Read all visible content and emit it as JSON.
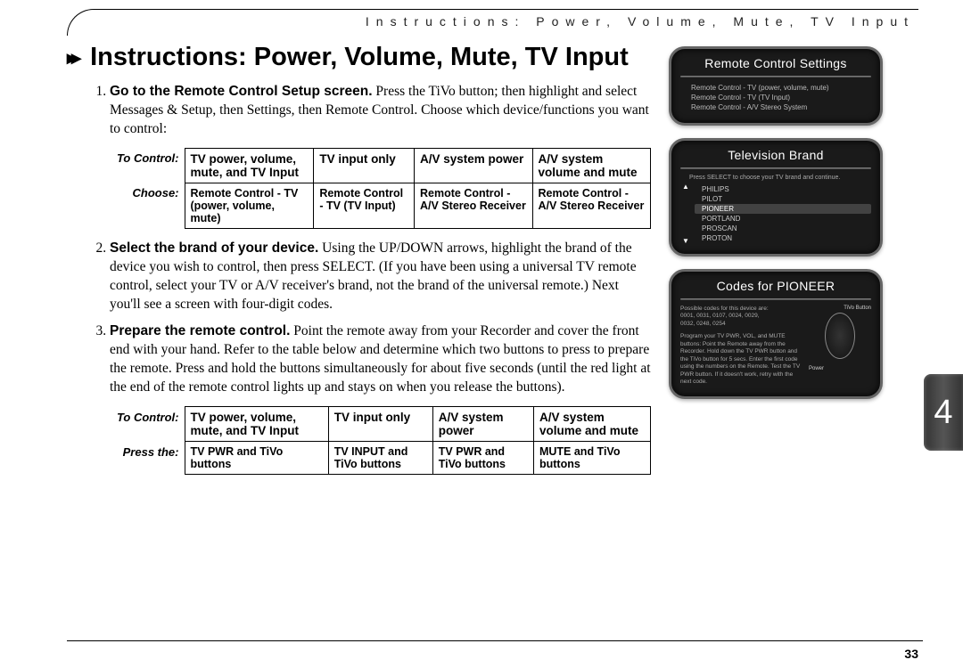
{
  "running_head": "Instructions: Power, Volume, Mute, TV Input",
  "title_icon": "▸▸",
  "title": "Instructions: Power, Volume, Mute, TV Input",
  "chapter_tab": "4",
  "page_number": "33",
  "step1": {
    "lead": "Go to the Remote Control Setup screen.",
    "body": " Press the TiVo button; then highlight and select Messages & Setup, then Settings, then Remote Control. Choose which device/functions you want to control:"
  },
  "table1": {
    "row1_label": "To Control:",
    "row2_label": "Choose:",
    "headers": [
      "TV power, volume, mute, and TV Input",
      "TV input only",
      "A/V system power",
      "A/V system volume and mute"
    ],
    "cells": [
      "Remote Control - TV (power, volume, mute)",
      "Remote Control - TV (TV Input)",
      "Remote Control - A/V Stereo Receiver",
      "Remote Control - A/V Stereo Receiver"
    ]
  },
  "step2": {
    "lead": "Select the brand of your device.",
    "body": " Using the UP/DOWN arrows, highlight the brand of the device you wish to control, then press SELECT. (If you have been using a universal TV remote control, select your TV or A/V receiver's brand, not the brand of the universal remote.) Next you'll see a screen with four-digit codes."
  },
  "step3": {
    "lead": "Prepare the remote control.",
    "body": " Point the remote away from your Recorder and cover the front end with your hand. Refer to the table below and determine which two buttons to press to prepare the remote. Press and hold the buttons simultaneously for about five seconds (until the red light at the end of the remote control lights up and stays on when you release the buttons)."
  },
  "table2": {
    "row1_label": "To Control:",
    "row2_label": "Press the:",
    "headers": [
      "TV power, volume, mute, and TV Input",
      "TV input only",
      "A/V system power",
      "A/V system volume and mute"
    ],
    "cells": [
      "TV PWR and TiVo buttons",
      "TV INPUT and TiVo buttons",
      "TV PWR and TiVo buttons",
      "MUTE and TiVo buttons"
    ]
  },
  "shot1": {
    "title": "Remote Control Settings",
    "items": [
      "Remote Control - TV (power, volume, mute)",
      "Remote Control - TV (TV Input)",
      "Remote Control - A/V Stereo System"
    ]
  },
  "shot2": {
    "title": "Television Brand",
    "caption": "Press SELECT to choose your TV brand and continue.",
    "brands": [
      "PHILIPS",
      "PILOT",
      "PIONEER",
      "PORTLAND",
      "PROSCAN",
      "PROTON"
    ],
    "selected_index": 2
  },
  "shot3": {
    "title": "Codes for PIONEER",
    "possible_label": "Possible codes for this device are:",
    "codes_line1": "0001, 0031, 0107, 0024, 0029,",
    "codes_line2": "0032, 0248, 0254",
    "program_text": "Program your TV PWR, VOL, and MUTE buttons: Point the Remote away from the Recorder. Hold down the TV PWR button and the TiVo button for 5 secs. Enter the first code using the numbers on the Remote. Test the TV PWR button. If it doesn't work, retry with the next code.",
    "diagram_labels": {
      "tivo": "TiVo Button",
      "power": "Power"
    }
  }
}
